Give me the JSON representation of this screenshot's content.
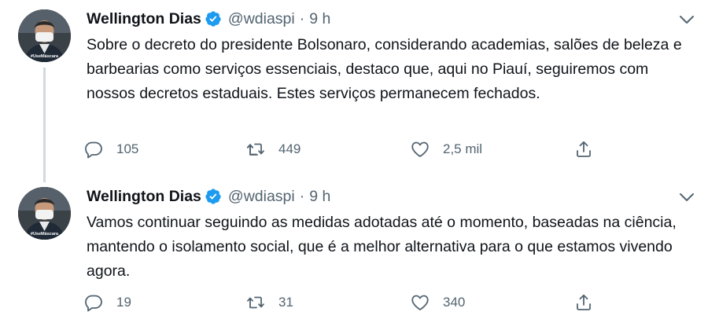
{
  "tweets": [
    {
      "author_name": "Wellington Dias",
      "handle": "@wdiaspi",
      "separator": "·",
      "time": "9 h",
      "avatar_caption": "#UseMáscara",
      "text": "Sobre o decreto do presidente Bolsonaro, considerando academias, salões de beleza e barbearias como serviços essenciais, destaco que, aqui no Piauí, seguiremos com nossos decretos estaduais. Estes serviços permanecem fechados.",
      "replies": "105",
      "retweets": "449",
      "likes": "2,5 mil"
    },
    {
      "author_name": "Wellington Dias",
      "handle": "@wdiaspi",
      "separator": "·",
      "time": "9 h",
      "avatar_caption": "#UseMáscara",
      "text": "Vamos continuar seguindo as medidas adotadas até o momento, baseadas na ciência, mantendo o isolamento social, que é a melhor alternativa para o que estamos vivendo agora.",
      "replies": "19",
      "retweets": "31",
      "likes": "340"
    }
  ],
  "colors": {
    "verified_blue": "#1d9bf0",
    "secondary_text": "#536471",
    "thread_line": "#cfd9de"
  },
  "icons": [
    "verified-badge-icon",
    "chevron-down-icon",
    "reply-icon",
    "retweet-icon",
    "like-icon",
    "share-icon"
  ]
}
